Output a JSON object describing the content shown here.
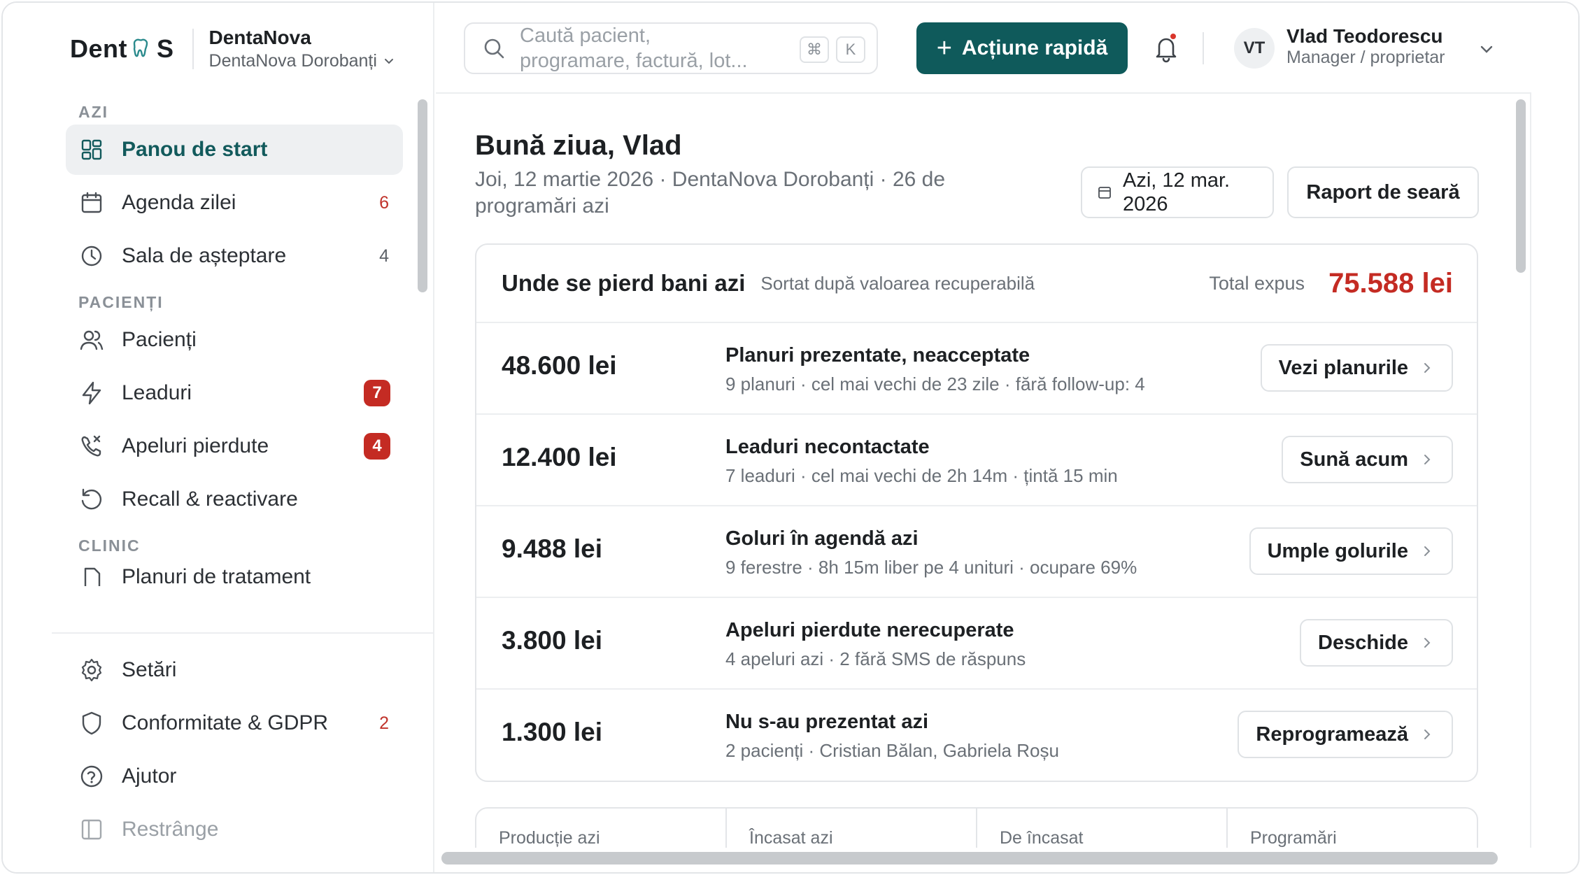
{
  "brand": {
    "logo_left": "Dent",
    "logo_right": "S",
    "clinic_name": "DentaNova",
    "clinic_location": "DentaNova Dorobanți"
  },
  "search": {
    "placeholder_line1": "Caută pacient,",
    "placeholder_line2": "programare, factură, lot...",
    "kbd_cmd": "⌘",
    "kbd_key": "K"
  },
  "topbar": {
    "quick_action_label": "Acțiune rapidă",
    "user_initials": "VT",
    "user_name": "Vlad Teodorescu",
    "user_role": "Manager / proprietar"
  },
  "sidebar": {
    "sections": [
      {
        "title": "AZI"
      },
      {
        "title": "PACIENȚI"
      },
      {
        "title": "CLINIC"
      }
    ],
    "items": [
      {
        "label": "Panou de start"
      },
      {
        "label": "Agenda zilei",
        "count": "6"
      },
      {
        "label": "Sala de așteptare",
        "count": "4"
      },
      {
        "label": "Pacienți"
      },
      {
        "label": "Leaduri",
        "badge": "7"
      },
      {
        "label": "Apeluri pierdute",
        "badge": "4"
      },
      {
        "label": "Recall & reactivare"
      },
      {
        "label": "Planuri de tratament"
      }
    ],
    "bottom": [
      {
        "label": "Setări"
      },
      {
        "label": "Conformitate & GDPR",
        "count": "2"
      },
      {
        "label": "Ajutor"
      },
      {
        "label": "Restrânge"
      }
    ]
  },
  "main": {
    "greeting": "Bună ziua, Vlad",
    "subtitle": "Joi, 12 martie 2026 · DentaNova Dorobanți · 26 de programări azi",
    "date_line1": "Azi, 12 mar.",
    "date_line2": "2026",
    "report_label": "Raport de seară"
  },
  "losses": {
    "title": "Unde se pierd bani azi",
    "sort_note": "Sortat după valoarea recuperabilă",
    "total_label": "Total expus",
    "total_value": "75.588 lei",
    "rows": [
      {
        "amount": "48.600 lei",
        "title": "Planuri prezentate, neacceptate",
        "detail": "9 planuri · cel mai vechi de 23 zile · fără follow-up: 4",
        "action": "Vezi planurile"
      },
      {
        "amount": "12.400 lei",
        "title": "Leaduri necontactate",
        "detail": "7 leaduri · cel mai vechi de 2h 14m · țintă 15 min",
        "action": "Sună acum"
      },
      {
        "amount": "9.488 lei",
        "title": "Goluri în agendă azi",
        "detail": "9 ferestre · 8h 15m liber pe 4 unituri · ocupare 69%",
        "action": "Umple golurile"
      },
      {
        "amount": "3.800 lei",
        "title": "Apeluri pierdute nerecuperate",
        "detail": "4 apeluri azi · 2 fără SMS de răspuns",
        "action": "Deschide"
      },
      {
        "amount": "1.300 lei",
        "title": "Nu s-au prezentat azi",
        "detail": "2 pacienți · Cristian Bălan, Gabriela Roșu",
        "action": "Reprogramează"
      }
    ]
  },
  "stats": [
    {
      "label": "Producție azi"
    },
    {
      "label": "Încasat azi"
    },
    {
      "label": "De încasat"
    },
    {
      "label": "Programări"
    }
  ],
  "colors": {
    "accent": "#0f5a5b",
    "danger": "#c42b23",
    "active_bg": "#eef0f2"
  },
  "icons": [
    "search-icon",
    "plus-icon",
    "bell-icon",
    "chevron-down-icon",
    "dashboard-icon",
    "calendar-icon",
    "clock-icon",
    "users-icon",
    "bolt-icon",
    "missed-call-icon",
    "refresh-icon",
    "document-icon",
    "gear-icon",
    "shield-icon",
    "help-icon",
    "sidebar-collapse-icon",
    "chevron-right-icon"
  ]
}
